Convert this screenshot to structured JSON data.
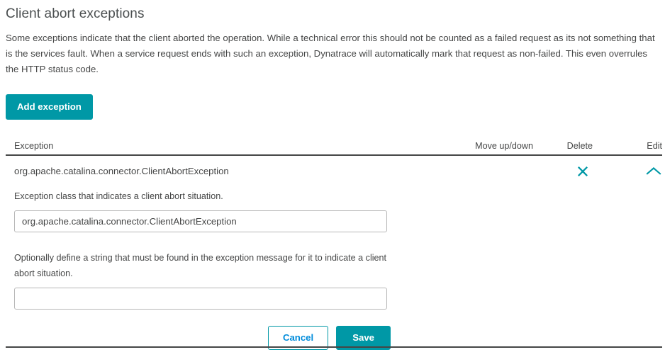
{
  "header": {
    "title": "Client abort exceptions",
    "description": "Some exceptions indicate that the client aborted the operation. While a technical error this should not be counted as a failed request as its not something that is the services fault. When a service request ends with such an exception, Dynatrace will automatically mark that request as non-failed. This even overrules the HTTP status code."
  },
  "toolbar": {
    "add_label": "Add exception"
  },
  "table": {
    "columns": {
      "exception": "Exception",
      "move": "Move up/down",
      "delete": "Delete",
      "edit": "Edit"
    },
    "rows": [
      {
        "exception": "org.apache.catalina.connector.ClientAbortException",
        "delete_icon": "close-icon",
        "edit_icon": "chevron-up-icon",
        "expanded": true
      }
    ]
  },
  "detail_form": {
    "class_label": "Exception class that indicates a client abort situation.",
    "class_value": "org.apache.catalina.connector.ClientAbortException",
    "class_placeholder": "",
    "message_label": "Optionally define a string that must be found in the exception message for it to indicate a client abort situation.",
    "message_value": "",
    "message_placeholder": "",
    "cancel_label": "Cancel",
    "save_label": "Save"
  },
  "colors": {
    "accent": "#0098a6",
    "text": "#454646",
    "link": "#008cdb",
    "input_border": "#b7b7b7",
    "rule": "#454646"
  }
}
